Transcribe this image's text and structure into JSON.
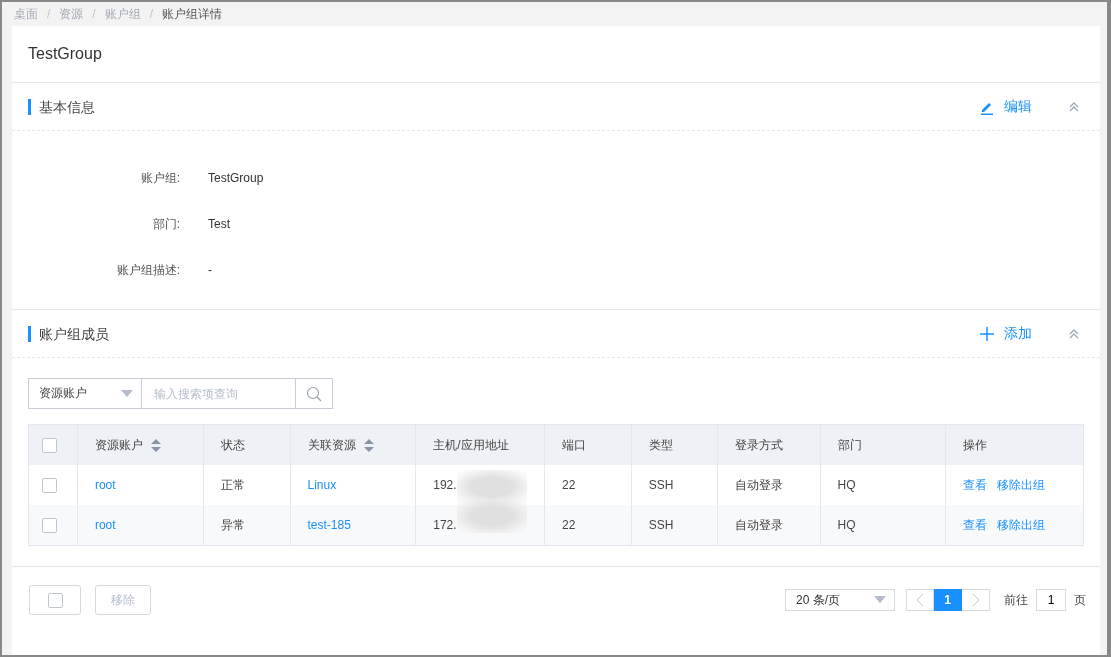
{
  "breadcrumb": {
    "separator": "/",
    "items": [
      {
        "label": "桌面",
        "current": false
      },
      {
        "label": "资源",
        "current": false
      },
      {
        "label": "账户组",
        "current": false
      },
      {
        "label": "账户组详情",
        "current": true
      }
    ]
  },
  "title": "TestGroup",
  "basic_info": {
    "title": "基本信息",
    "action": "编辑",
    "expanded": true,
    "fields": [
      {
        "label": "账户组:",
        "value": "TestGroup"
      },
      {
        "label": "部门:",
        "value": "Test"
      },
      {
        "label": "账户组描述:",
        "value": "-"
      }
    ]
  },
  "members": {
    "title": "账户组成员",
    "action": "添加",
    "expanded": true,
    "search": {
      "filter": "资源账户",
      "placeholder": "输入搜索项查询"
    },
    "table": {
      "all_checked": false,
      "columns": [
        {
          "label": "资源账户",
          "sortable": true
        },
        {
          "label": "状态",
          "sortable": false
        },
        {
          "label": "关联资源",
          "sortable": true
        },
        {
          "label": "主机/应用地址",
          "sortable": false
        },
        {
          "label": "端口",
          "sortable": false
        },
        {
          "label": "类型",
          "sortable": false
        },
        {
          "label": "登录方式",
          "sortable": false
        },
        {
          "label": "部门",
          "sortable": false
        },
        {
          "label": "操作",
          "sortable": false
        }
      ],
      "rows": [
        {
          "checked": false,
          "account": "root",
          "status": "正常",
          "resource": "Linux",
          "address": "192.",
          "port": "22",
          "type": "SSH",
          "login": "自动登录",
          "dept": "HQ",
          "actions": [
            "查看",
            "移除出组"
          ]
        },
        {
          "checked": false,
          "account": "root",
          "status": "异常",
          "resource": "test-185",
          "address": "172.",
          "port": "22",
          "type": "SSH",
          "login": "自动登录",
          "dept": "HQ",
          "actions": [
            "查看",
            "移除出组"
          ]
        }
      ]
    }
  },
  "footer": {
    "select_all_checked": false,
    "remove_button": {
      "label": "移除",
      "disabled": true
    },
    "page_size": "20 条/页",
    "pages": [
      {
        "label": "1",
        "selected": true
      }
    ],
    "goto": {
      "prefix": "前往",
      "value": "1",
      "suffix": "页"
    }
  }
}
